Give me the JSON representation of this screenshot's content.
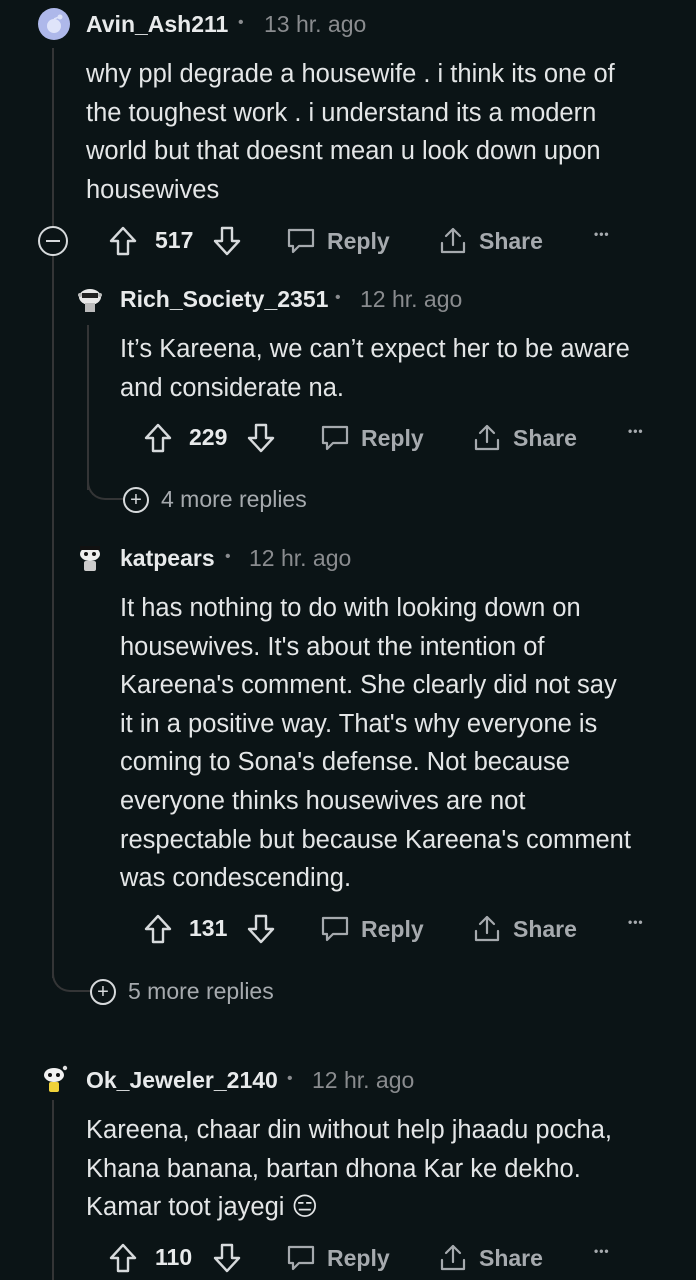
{
  "comments": [
    {
      "username": "Avin_Ash211",
      "time": "13 hr. ago",
      "body": "why ppl degrade a housewife . i think its one of\nthe toughest work . i understand its a modern\nworld but that doesnt mean u look down upon\nhousewives",
      "votes": "517",
      "reply_label": "Reply",
      "share_label": "Share",
      "more": "•••"
    },
    {
      "username": "Rich_Society_2351",
      "time": "12 hr. ago",
      "body": "It’s Kareena, we can’t expect her to be aware\nand considerate na.",
      "votes": "229",
      "reply_label": "Reply",
      "share_label": "Share",
      "more": "•••",
      "more_replies": "4 more replies"
    },
    {
      "username": "katpears",
      "time": "12 hr. ago",
      "body": "It has nothing to do with looking down on\nhousewives. It's about the intention of\nKareena's comment. She clearly did not say\nit in a positive way. That's why everyone is\ncoming to Sona's defense. Not because\neveryone thinks housewives are not\nrespectable but because Kareena's comment\nwas condescending.",
      "votes": "131",
      "reply_label": "Reply",
      "share_label": "Share",
      "more": "•••"
    },
    {
      "username": "Ok_Jeweler_2140",
      "time": "12 hr. ago",
      "body": "Kareena, chaar din without help jhaadu pocha,\nKhana banana, bartan dhona Kar ke dekho.\nKamar toot jayegi 😑",
      "votes": "110",
      "reply_label": "Reply",
      "share_label": "Share",
      "more": "•••"
    }
  ],
  "thread": {
    "more_replies": "5 more replies"
  },
  "separator": "•",
  "plus": "+",
  "icons": {
    "upvote": "upvote-arrow-icon",
    "downvote": "downvote-arrow-icon",
    "reply": "speech-bubble-icon",
    "share": "share-upload-icon",
    "collapse": "collapse-minus-icon"
  }
}
